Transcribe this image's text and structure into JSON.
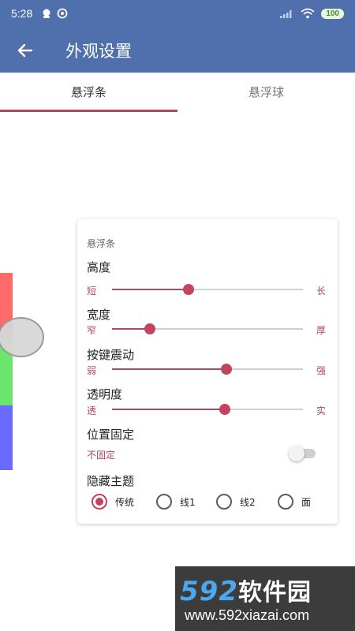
{
  "status_bar": {
    "time": "5:28",
    "battery": "100",
    "icons": [
      "notification-icon",
      "sync-icon",
      "signal-icon",
      "wifi-icon",
      "battery-icon"
    ]
  },
  "app_bar": {
    "title": "外观设置",
    "back_icon": "arrow-back-icon"
  },
  "tabs": [
    {
      "label": "悬浮条",
      "selected": true
    },
    {
      "label": "悬浮球",
      "selected": false
    }
  ],
  "preview": {
    "colors": [
      "#ff6b6b",
      "#6ce56c",
      "#6a6aff"
    ]
  },
  "card": {
    "title": "悬浮条",
    "sliders": [
      {
        "label": "高度",
        "min_label": "短",
        "max_label": "长",
        "value": 0.4
      },
      {
        "label": "宽度",
        "min_label": "窄",
        "max_label": "厚",
        "value": 0.2
      },
      {
        "label": "按键震动",
        "min_label": "弱",
        "max_label": "强",
        "value": 0.6
      },
      {
        "label": "透明度",
        "min_label": "透",
        "max_label": "实",
        "value": 0.59
      }
    ],
    "position_fixed": {
      "label": "位置固定",
      "value_text": "不固定",
      "on": false
    },
    "hide_theme": {
      "label": "隐藏主题",
      "options": [
        "传统",
        "线1",
        "线2",
        "面"
      ],
      "selected": 0
    }
  },
  "watermark": {
    "number": "592",
    "brand": "软件园",
    "url": "www.592xiazai.com"
  },
  "colors": {
    "primary": "#4f6fad",
    "accent": "#b0485f"
  }
}
